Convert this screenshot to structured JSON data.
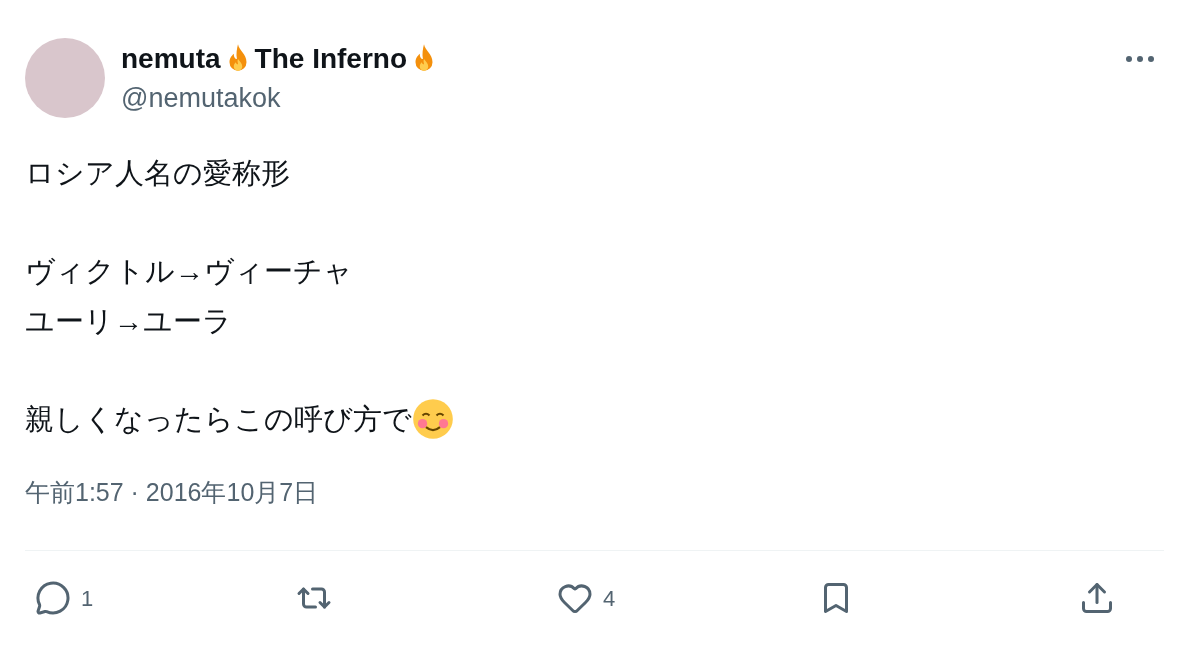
{
  "author": {
    "name_parts": [
      "nemuta",
      "The Inferno"
    ],
    "handle": "@nemutakok"
  },
  "paragraphs": [
    [
      "ロシア人名の愛称形"
    ],
    [
      "ヴィクトル→ヴィーチャ",
      "ユーリ→ユーラ"
    ],
    [
      "親しくなったらこの呼び方で"
    ]
  ],
  "timestamp": "午前1:57 · 2016年10月7日",
  "actions": [
    {
      "kind": "reply",
      "count": "1"
    },
    {
      "kind": "repost"
    },
    {
      "kind": "like",
      "count": "4"
    },
    {
      "kind": "bookmark"
    },
    {
      "kind": "share"
    }
  ]
}
